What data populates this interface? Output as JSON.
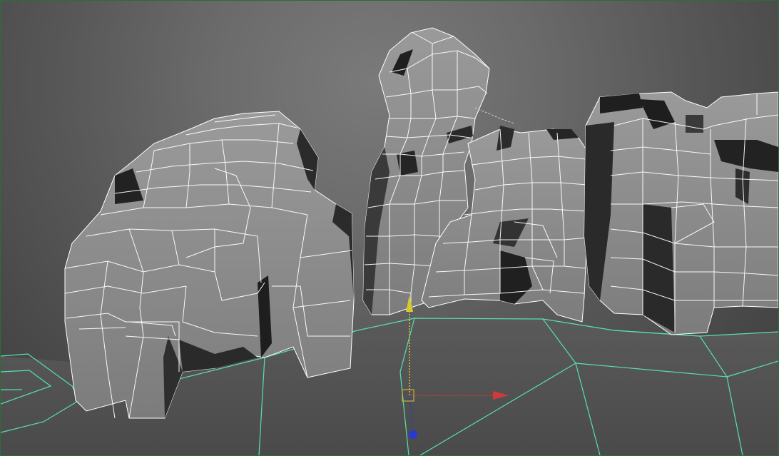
{
  "viewport": {
    "label": "",
    "background": "#6b6b6b",
    "wire_color": "#ffffff",
    "ground_grid_color": "#58e0b0",
    "mesh_face_color": "#8a8a8a",
    "mesh_shadow_color": "#2b2b2b"
  },
  "manipulator": {
    "axes": [
      "x-axis",
      "y-axis",
      "z-axis"
    ],
    "colors": {
      "x": "#d03a3a",
      "y": "#d8c830",
      "z": "#2a3ad0",
      "center": "#c8b040"
    }
  }
}
